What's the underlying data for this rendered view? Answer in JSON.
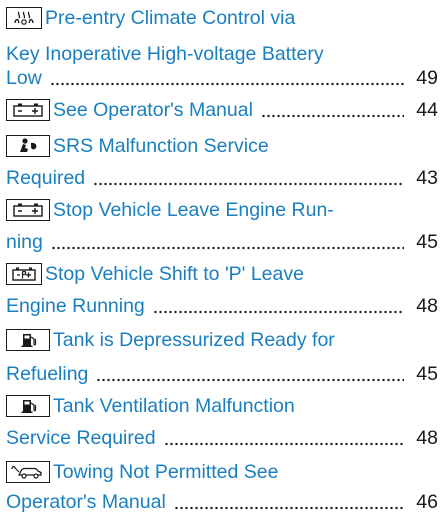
{
  "entries": [
    {
      "icon": "climate-control-icon",
      "lines": [
        "Pre-entry Climate Control via",
        "Key Inoperative High-voltage Battery",
        "Low"
      ],
      "page": "49"
    },
    {
      "icon": "battery-warning-icon",
      "lines": [
        "See Operator's Manual"
      ],
      "page": "44"
    },
    {
      "icon": "srs-airbag-icon",
      "lines": [
        "SRS Malfunction Service",
        "Required"
      ],
      "page": "43"
    },
    {
      "icon": "battery-warning-icon",
      "lines": [
        "Stop Vehicle Leave Engine Run-",
        "ning"
      ],
      "page": "45"
    },
    {
      "icon": "battery-park-icon",
      "lines": [
        "Stop Vehicle Shift to 'P' Leave",
        "Engine Running"
      ],
      "page": "48"
    },
    {
      "icon": "fuel-pump-icon",
      "lines": [
        "Tank is Depressurized Ready for",
        "Refueling"
      ],
      "page": "45"
    },
    {
      "icon": "fuel-pump-icon",
      "lines": [
        "Tank Ventilation Malfunction",
        "Service Required"
      ],
      "page": "48"
    },
    {
      "icon": "tow-car-icon",
      "lines": [
        "Towing Not Permitted See",
        "Operator's Manual"
      ],
      "page": "46"
    }
  ]
}
